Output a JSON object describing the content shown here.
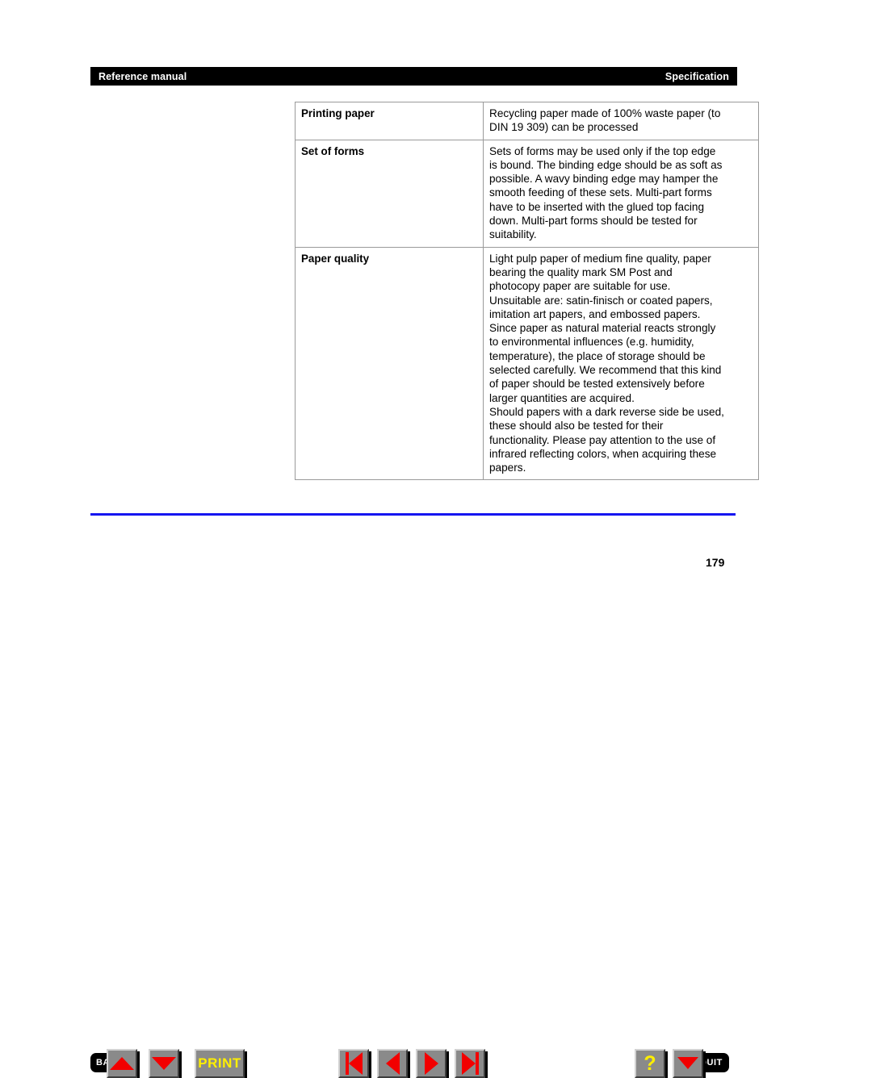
{
  "header": {
    "left_title": "Reference manual",
    "right_title": "Specification"
  },
  "table": {
    "rows": [
      {
        "label": "Printing paper",
        "lines": [
          "Recycling paper made of 100% waste paper (to",
          "DIN 19 309) can be processed"
        ]
      },
      {
        "label": "Set of forms",
        "lines": [
          "Sets of forms may be used only if the top edge",
          "is bound. The binding edge should be as soft as",
          "possible. A wavy binding edge may hamper the",
          "smooth feeding of these sets. Multi-part forms",
          "have to be inserted with the glued top facing",
          "down. Multi-part forms should be tested for",
          "suitability."
        ]
      },
      {
        "label": "Paper quality",
        "lines": [
          "Light pulp paper of medium fine quality, paper",
          "bearing the quality mark SM Post and",
          "photocopy paper are suitable for use.",
          "Unsuitable are: satin-finisch or coated papers,",
          "imitation art papers, and embossed papers.",
          "Since paper as natural material reacts strongly",
          "to environmental influences (e.g. humidity,",
          "temperature), the place of storage should be",
          "selected carefully. We recommend that this kind",
          "of paper should be tested extensively before",
          "larger quantities are acquired.",
          "Should papers with a dark reverse side be used,",
          "these should also be tested for their",
          "functionality. Please pay attention to the use of",
          "infrared reflecting colors, when acquiring these",
          "papers."
        ]
      }
    ]
  },
  "toolbar": {
    "back_label": "BACK",
    "print_label": "PRINT",
    "quit_label": "QUIT",
    "help_label": "?",
    "icons": {
      "up": "triangle-up-icon",
      "down": "triangle-down-icon",
      "first": "first-page-icon",
      "prev": "previous-page-icon",
      "next": "next-page-icon",
      "last": "last-page-icon"
    }
  },
  "footer": {
    "page_number": "179"
  },
  "colors": {
    "header_bar": "#000000",
    "rule": "#1515f0",
    "button_face": "#8a8a8a",
    "arrow_red": "#f20000",
    "label_yellow": "#ffef00"
  }
}
